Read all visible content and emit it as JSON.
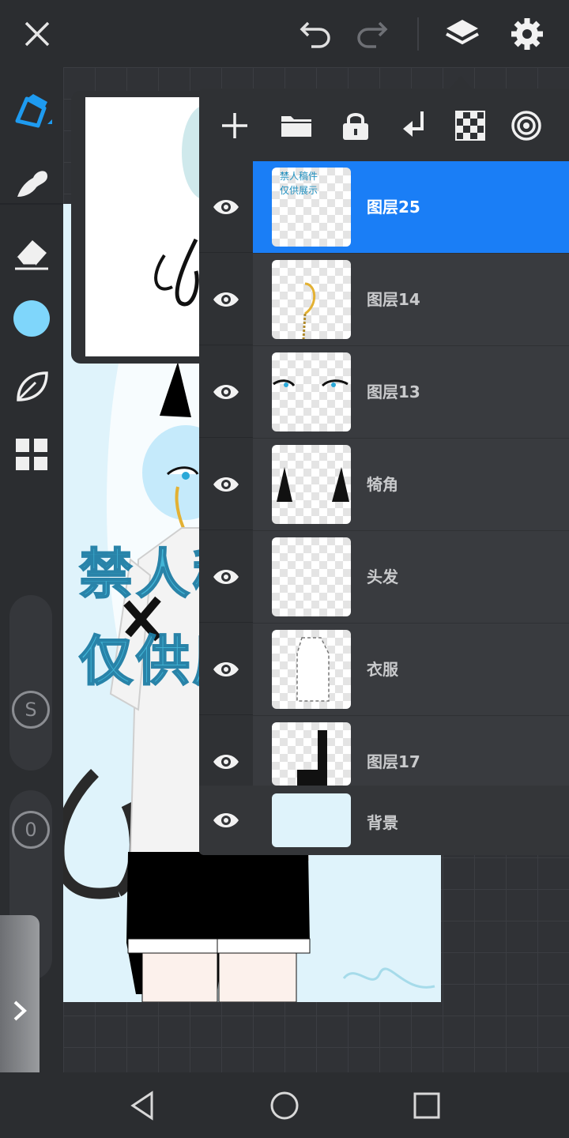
{
  "topbar": {
    "close_icon": "close-icon",
    "undo_icon": "undo-icon",
    "redo_icon": "redo-icon",
    "layers_icon": "layers-icon",
    "settings_icon": "gear-icon"
  },
  "tools": [
    {
      "name": "pen-tool",
      "icon": "pen-icon",
      "active": true
    },
    {
      "name": "smudge-tool",
      "icon": "smudge-icon"
    },
    {
      "name": "eraser-tool",
      "icon": "eraser-icon"
    },
    {
      "name": "color-picker",
      "icon": "color-swatch",
      "color": "#7fd6fb"
    },
    {
      "name": "brush-library",
      "icon": "leaf-icon"
    },
    {
      "name": "gallery-grid",
      "icon": "grid-icon"
    }
  ],
  "sliders": {
    "size_label": "S",
    "opacity_label": "0"
  },
  "colors": {
    "accent": "#1a7ef6",
    "active_tool": "#1e9bf0",
    "canvas_background": "#dff3fb",
    "current_color": "#7fd6fb"
  },
  "canvas": {
    "watermark_line1": "禁人稿件",
    "watermark_line2": "仅供展示"
  },
  "layers_panel": {
    "toolbar_icons": [
      "add-icon",
      "folder-icon",
      "lock-icon",
      "merge-down-icon",
      "transparency-icon",
      "target-icon"
    ],
    "layers": [
      {
        "name": "图层25",
        "selected": true,
        "thumb_text": "禁人稿件\n仅供展示"
      },
      {
        "name": "图层14",
        "selected": false
      },
      {
        "name": "图层13",
        "selected": false
      },
      {
        "name": "犄角",
        "selected": false
      },
      {
        "name": "头发",
        "selected": false
      },
      {
        "name": "衣服",
        "selected": false
      },
      {
        "name": "图层17",
        "selected": false
      }
    ],
    "background_layer": {
      "name": "背景"
    }
  },
  "navbar": {
    "back_icon": "back-icon",
    "home_icon": "home-icon",
    "recents_icon": "recents-icon"
  }
}
